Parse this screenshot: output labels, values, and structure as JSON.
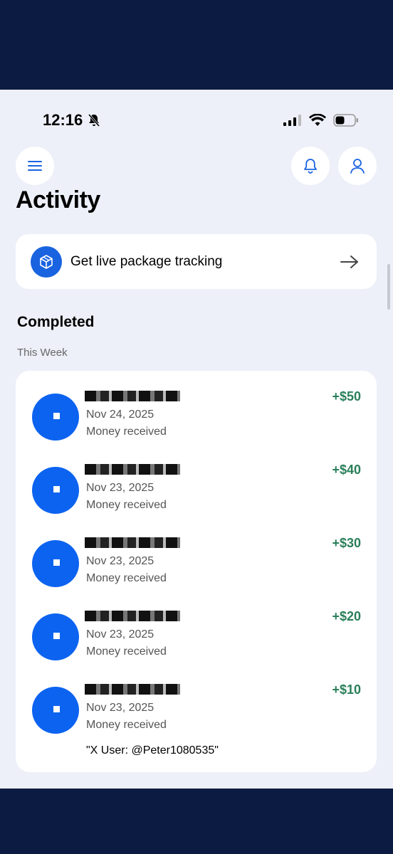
{
  "status_bar": {
    "time": "12:16"
  },
  "header": {
    "title": "Activity"
  },
  "promo": {
    "label": "Get live package tracking"
  },
  "section": {
    "title": "Completed",
    "subtitle": "This Week"
  },
  "transactions": [
    {
      "date": "Nov 24, 2025",
      "type": "Money received",
      "amount": "+$50"
    },
    {
      "date": "Nov 23, 2025",
      "type": "Money received",
      "amount": "+$40"
    },
    {
      "date": "Nov 23, 2025",
      "type": "Money received",
      "amount": "+$30"
    },
    {
      "date": "Nov 23, 2025",
      "type": "Money received",
      "amount": "+$20"
    },
    {
      "date": "Nov 23, 2025",
      "type": "Money received",
      "amount": "+$10",
      "note": "\"X User: @Peter1080535\""
    }
  ],
  "colors": {
    "accent": "#1a63e0",
    "positive": "#2a7f5a",
    "frame": "#0c1b42"
  }
}
